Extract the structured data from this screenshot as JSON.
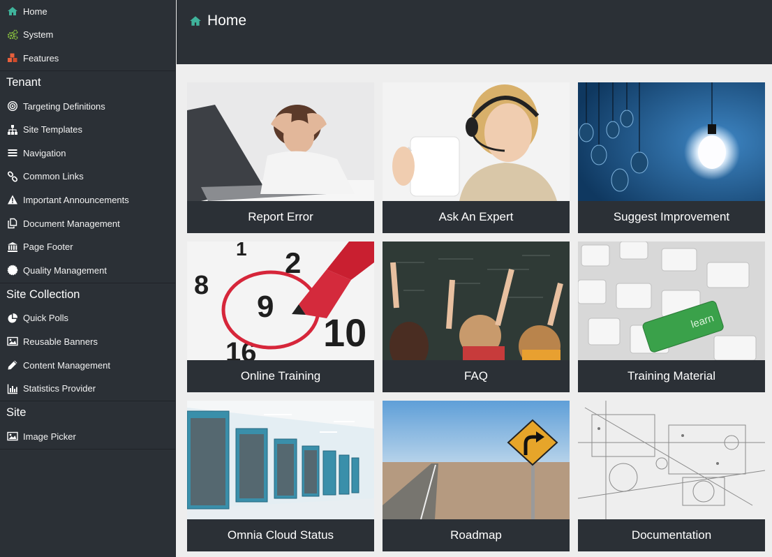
{
  "sidebar": {
    "top_items": [
      {
        "label": "Home",
        "icon": "home-icon"
      },
      {
        "label": "System",
        "icon": "cogs-icon"
      },
      {
        "label": "Features",
        "icon": "cubes-icon"
      }
    ],
    "sections": [
      {
        "title": "Tenant",
        "items": [
          {
            "label": "Targeting Definitions",
            "icon": "target-icon"
          },
          {
            "label": "Site Templates",
            "icon": "sitemap-icon"
          },
          {
            "label": "Navigation",
            "icon": "bars-icon"
          },
          {
            "label": "Common Links",
            "icon": "link-icon"
          },
          {
            "label": "Important Announcements",
            "icon": "warning-icon"
          },
          {
            "label": "Document Management",
            "icon": "copy-icon"
          },
          {
            "label": "Page Footer",
            "icon": "bank-icon"
          },
          {
            "label": "Quality Management",
            "icon": "certificate-icon"
          }
        ]
      },
      {
        "title": "Site Collection",
        "items": [
          {
            "label": "Quick Polls",
            "icon": "pie-chart-icon"
          },
          {
            "label": "Reusable Banners",
            "icon": "image-icon"
          },
          {
            "label": "Content Management",
            "icon": "pencil-icon"
          },
          {
            "label": "Statistics Provider",
            "icon": "bar-chart-icon"
          }
        ]
      },
      {
        "title": "Site",
        "items": [
          {
            "label": "Image Picker",
            "icon": "image-icon"
          }
        ]
      }
    ]
  },
  "header": {
    "title": "Home",
    "icon": "home-icon"
  },
  "tiles": [
    {
      "label": "Report Error",
      "image": "stressed-woman-laptop-photo"
    },
    {
      "label": "Ask An Expert",
      "image": "support-agent-headset-photo"
    },
    {
      "label": "Suggest Improvement",
      "image": "lightbulbs-photo"
    },
    {
      "label": "Online Training",
      "image": "calendar-marker-photo"
    },
    {
      "label": "FAQ",
      "image": "classroom-raised-hands-photo"
    },
    {
      "label": "Training Material",
      "image": "keyboard-learn-key-photo"
    },
    {
      "label": "Omnia Cloud Status",
      "image": "server-room-photo"
    },
    {
      "label": "Roadmap",
      "image": "road-sign-photo"
    },
    {
      "label": "Documentation",
      "image": "blueprint-photo"
    }
  ],
  "colors": {
    "sidebar_bg": "#2b3036",
    "content_bg": "#eeeeee",
    "home_icon": "#3fb39b",
    "system_icon": "#8cc63f",
    "features_icon": "#e8603c"
  }
}
